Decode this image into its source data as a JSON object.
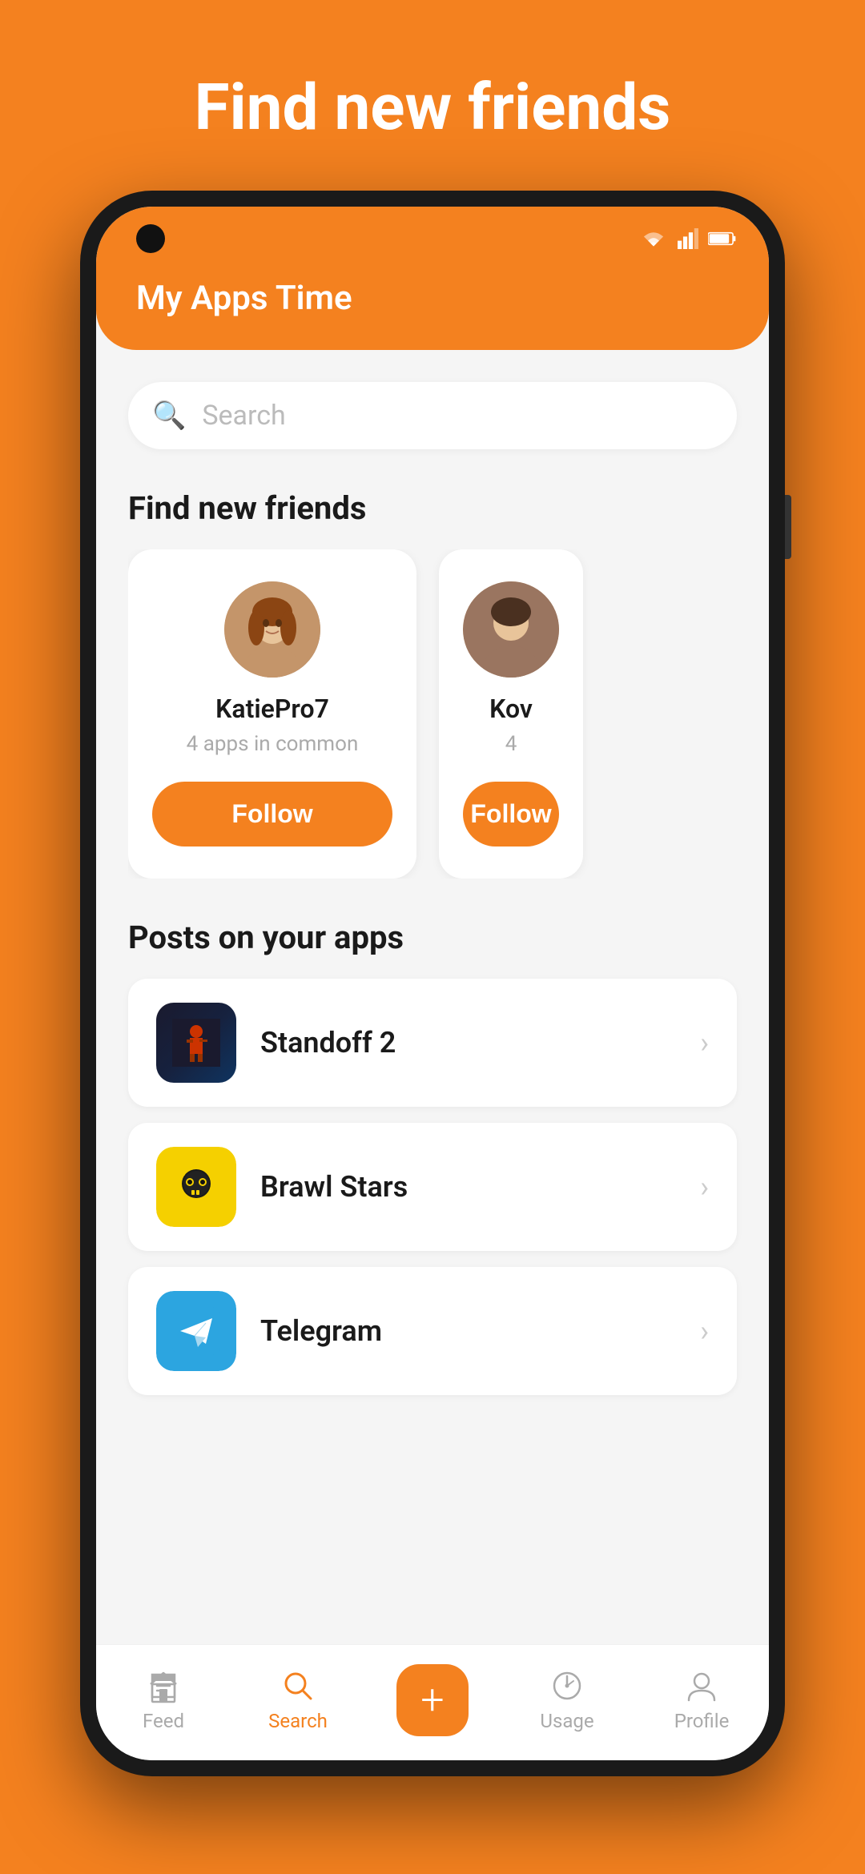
{
  "page": {
    "background_color": "#F4811F",
    "hero_title": "Find new friends"
  },
  "header": {
    "app_name": "My Apps Time"
  },
  "search": {
    "placeholder": "Search"
  },
  "find_friends": {
    "section_title": "Find new friends",
    "friends": [
      {
        "username": "KatiePro7",
        "common_apps": "4 apps in common",
        "follow_label": "Follow"
      },
      {
        "username": "Kov",
        "common_apps": "4",
        "follow_label": "Follow"
      }
    ]
  },
  "posts_section": {
    "section_title": "Posts on your apps",
    "apps": [
      {
        "name": "Standoff 2",
        "icon_type": "standoff"
      },
      {
        "name": "Brawl Stars",
        "icon_type": "brawl"
      },
      {
        "name": "Telegram",
        "icon_type": "telegram"
      }
    ]
  },
  "bottom_nav": {
    "items": [
      {
        "label": "Feed",
        "icon": "feed",
        "active": false
      },
      {
        "label": "Search",
        "icon": "search",
        "active": true
      },
      {
        "label": "Add",
        "icon": "plus",
        "active": false
      },
      {
        "label": "Usage",
        "icon": "usage",
        "active": false
      },
      {
        "label": "Profile",
        "icon": "profile",
        "active": false
      }
    ]
  }
}
